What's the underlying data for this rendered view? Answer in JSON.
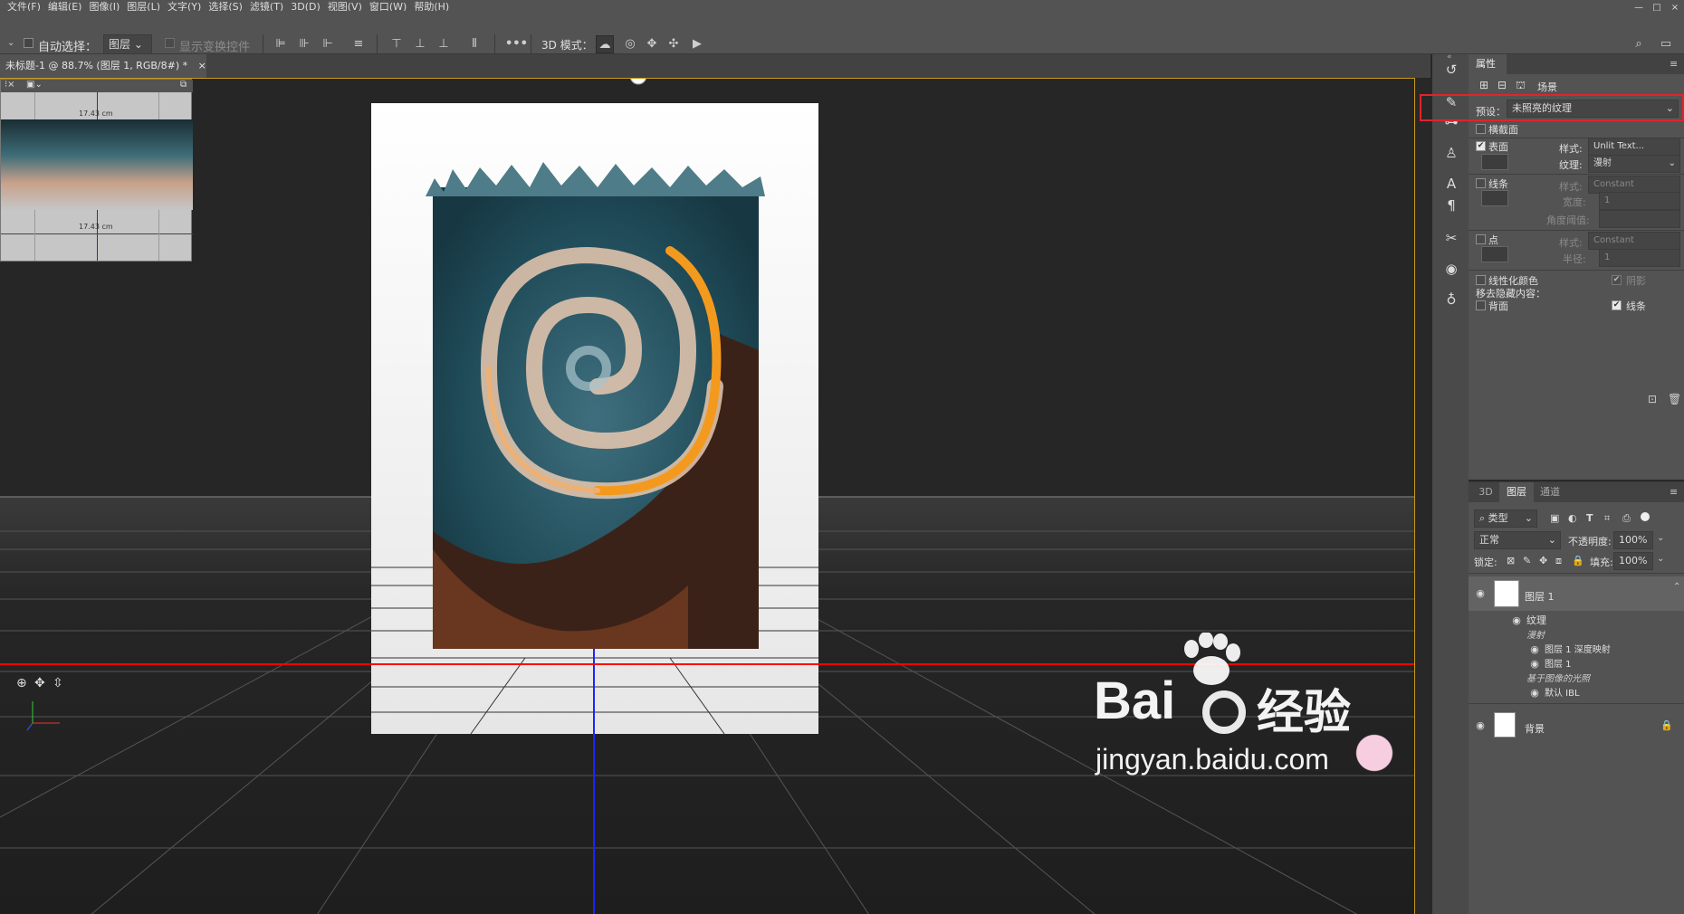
{
  "menu": [
    "文件(F)",
    "编辑(E)",
    "图像(I)",
    "图层(L)",
    "文字(Y)",
    "选择(S)",
    "滤镜(T)",
    "3D(D)",
    "视图(V)",
    "窗口(W)",
    "帮助(H)"
  ],
  "options": {
    "auto_select_label": "自动选择：",
    "auto_select_value": "图层",
    "show_transform_label": "显示变换控件",
    "mode3d_label": "3D 模式："
  },
  "document": {
    "tab_title": "未标题-1 @ 88.7% (图层 1, RGB/8#) *",
    "secondary_view_measure_top": "17.43 cm",
    "secondary_view_measure_bottom": "17.43 cm"
  },
  "properties": {
    "panel_title": "属性",
    "scene_label": "场景",
    "preset_label": "预设：",
    "preset_value": "未照亮的纹理",
    "cross_section": "横截面",
    "surface": "表面",
    "style_label": "样式:",
    "surface_style": "Unlit Text...",
    "texture_label": "纹理:",
    "texture_value": "漫射",
    "lines": "线条",
    "lines_style": "Constant",
    "width_label": "宽度:",
    "width_value": "1",
    "angle_label": "角度阈值:",
    "points": "点",
    "points_style": "Constant",
    "radius_label": "半径:",
    "radius_value": "1",
    "linearize_colors": "线性化颜色",
    "shadow": "阴影",
    "remove_hidden": "移去隐藏内容：",
    "backface": "背面",
    "lines_hidden": "线条"
  },
  "layers_panel": {
    "tabs": [
      "3D",
      "图层",
      "通道"
    ],
    "filter_value": "类型",
    "blend_mode": "正常",
    "opacity_label": "不透明度:",
    "opacity_value": "100%",
    "lock_label": "锁定:",
    "fill_label": "填充:",
    "fill_value": "100%",
    "layers": [
      {
        "name": "图层 1",
        "level": 0
      },
      {
        "name": "纹理",
        "level": 1
      },
      {
        "name": "漫射",
        "level": 1,
        "italic": true
      },
      {
        "name": "图层 1 深度映射",
        "level": 2
      },
      {
        "name": "图层 1",
        "level": 2
      },
      {
        "name": "基于图像的光照",
        "level": 1,
        "italic": true
      },
      {
        "name": "默认 IBL",
        "level": 2
      },
      {
        "name": "背景",
        "level": 0
      }
    ]
  },
  "watermark": {
    "brand": "Bai",
    "brand2": "经验",
    "url": "jingyan.baidu.com"
  },
  "colors": {
    "accent_red": "#e0242a",
    "panel_bg": "#535353",
    "canvas_bg": "#262626"
  }
}
